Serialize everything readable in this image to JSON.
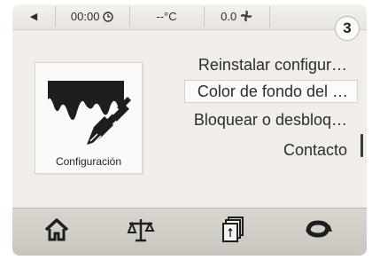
{
  "status_bar": {
    "back_icon": "left-triangle-icon",
    "time": "00:00",
    "time_icon": "clock-icon",
    "temperature": "--°C",
    "speed": "0.0",
    "speed_icon": "fan-icon"
  },
  "step_badge": "3",
  "config_tile": {
    "label": "Configuración",
    "icon": "paint-brush-icon"
  },
  "menu": {
    "items": [
      {
        "label": "Reinstalar configur…"
      },
      {
        "label": "Color de fondo del …",
        "selected": true
      },
      {
        "label": "Bloquear o desbloq…"
      },
      {
        "label": "Contacto"
      }
    ]
  },
  "bottom_bar": {
    "icons": [
      "home-icon",
      "scale-icon",
      "recipe-cards-icon",
      "refresh-icon"
    ]
  },
  "colors": {
    "screen_bg": "#f1eee9",
    "bottom_bar": "#d0ccc5",
    "text": "#2d2d2d",
    "selected_bg": "#fcfbf9"
  }
}
